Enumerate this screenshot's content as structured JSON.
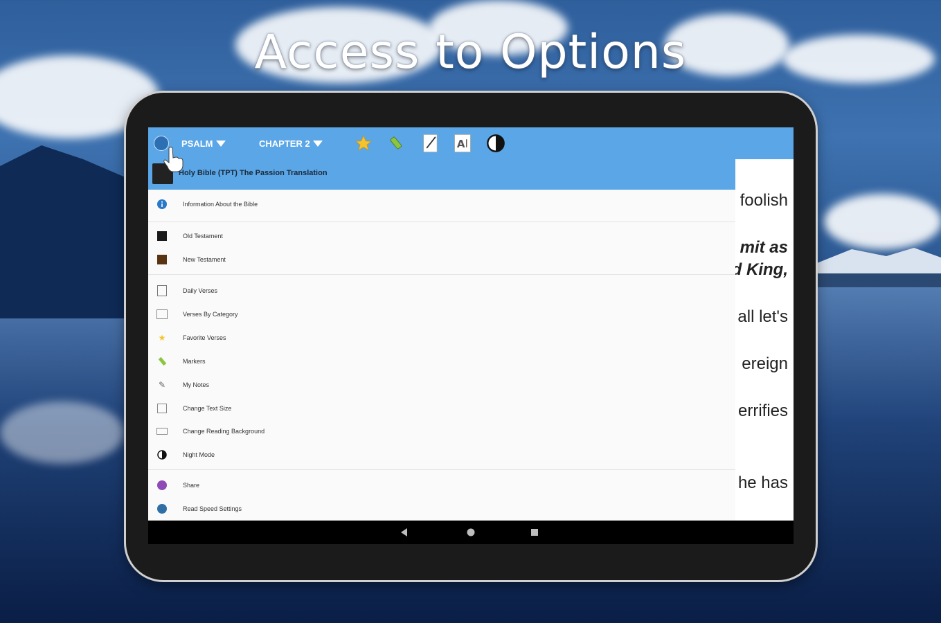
{
  "headline": "Access to Options",
  "toolbar": {
    "book_label": "PSALM",
    "chapter_label": "CHAPTER 2",
    "icons": [
      "menu-icon",
      "star-icon",
      "marker-icon",
      "notes-icon",
      "text-size-icon",
      "night-mode-icon"
    ]
  },
  "drawer": {
    "title": "Holy Bible (TPT) The Passion Translation",
    "items": [
      {
        "label": "Information About the Bible",
        "icon": "info-icon"
      },
      {
        "label": "Old Testament",
        "icon": "old-testament-icon"
      },
      {
        "label": "New Testament",
        "icon": "new-testament-icon"
      },
      {
        "label": "Daily Verses",
        "icon": "daily-verses-icon"
      },
      {
        "label": "Verses By Category",
        "icon": "category-icon"
      },
      {
        "label": "Favorite Verses",
        "icon": "star-icon"
      },
      {
        "label": "Markers",
        "icon": "marker-icon"
      },
      {
        "label": "My Notes",
        "icon": "notes-icon"
      },
      {
        "label": "Change Text Size",
        "icon": "text-size-icon"
      },
      {
        "label": "Change Reading Background",
        "icon": "background-icon"
      },
      {
        "label": "Night Mode",
        "icon": "night-mode-icon"
      },
      {
        "label": "Share",
        "icon": "share-icon"
      },
      {
        "label": "Read Speed Settings",
        "icon": "speed-icon"
      }
    ]
  },
  "reading": {
    "lines": [
      "foolish",
      "mit as",
      "d King,",
      "all let's",
      "ereign",
      "errifies",
      "he has"
    ]
  },
  "navbar": {
    "buttons": [
      "back-icon",
      "home-icon",
      "recents-icon"
    ]
  },
  "colors": {
    "accent": "#5aa6e6",
    "drawer_bg": "#fafafa"
  }
}
